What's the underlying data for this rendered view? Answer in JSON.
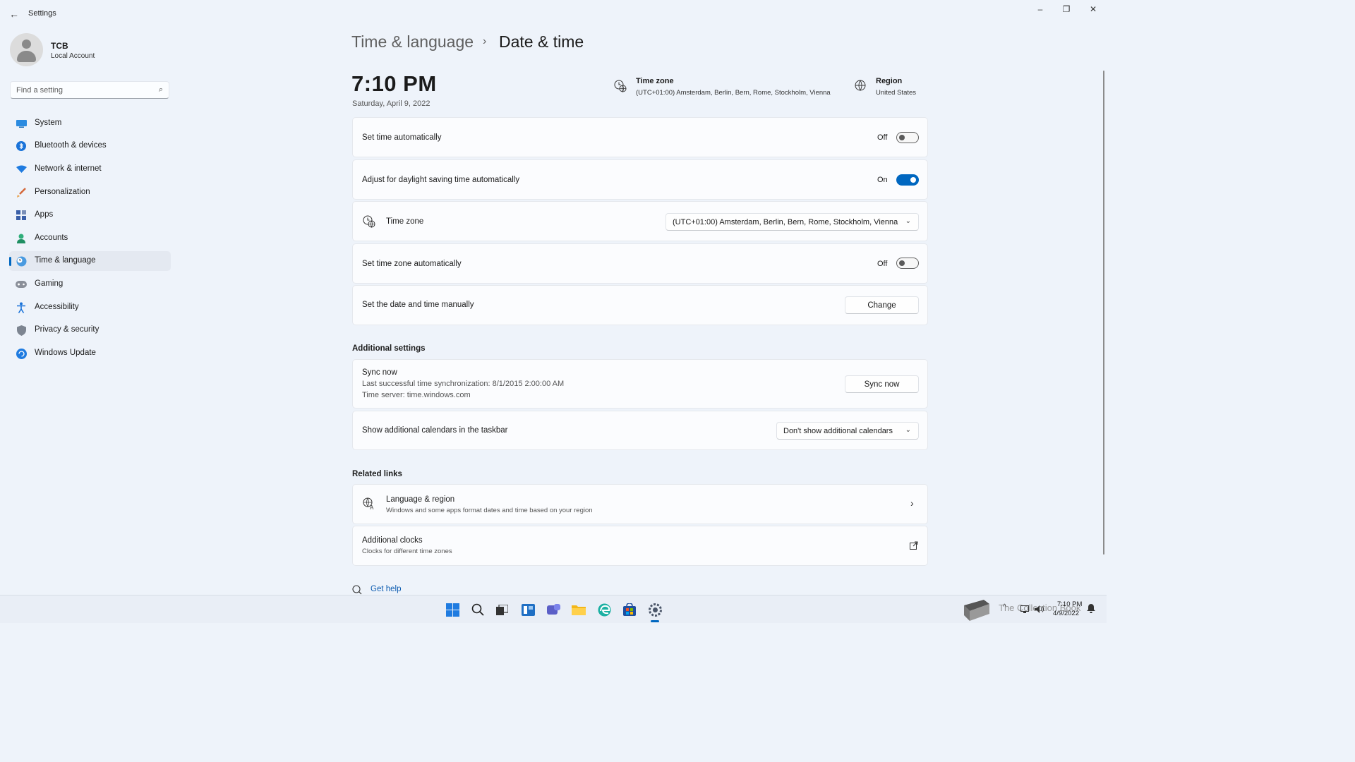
{
  "window": {
    "title": "Settings",
    "minimize": "–",
    "maximize": "❐",
    "close": "✕"
  },
  "profile": {
    "name": "TCB",
    "account_type": "Local Account"
  },
  "search": {
    "placeholder": "Find a setting"
  },
  "nav": [
    {
      "label": "System",
      "icon": "monitor-icon"
    },
    {
      "label": "Bluetooth & devices",
      "icon": "bluetooth-icon"
    },
    {
      "label": "Network & internet",
      "icon": "wifi-icon"
    },
    {
      "label": "Personalization",
      "icon": "brush-icon"
    },
    {
      "label": "Apps",
      "icon": "apps-icon"
    },
    {
      "label": "Accounts",
      "icon": "person-icon"
    },
    {
      "label": "Time & language",
      "icon": "globe-clock-icon",
      "active": true
    },
    {
      "label": "Gaming",
      "icon": "gamepad-icon"
    },
    {
      "label": "Accessibility",
      "icon": "accessibility-icon"
    },
    {
      "label": "Privacy & security",
      "icon": "shield-icon"
    },
    {
      "label": "Windows Update",
      "icon": "update-icon"
    }
  ],
  "breadcrumb": {
    "parent": "Time & language",
    "separator": "›",
    "current": "Date & time"
  },
  "header": {
    "time": "7:10 PM",
    "date": "Saturday, April 9, 2022",
    "timezone_label": "Time zone",
    "timezone_value": "(UTC+01:00) Amsterdam, Berlin, Bern, Rome, Stockholm, Vienna",
    "region_label": "Region",
    "region_value": "United States"
  },
  "settings": {
    "set_time_auto": {
      "label": "Set time automatically",
      "state": "Off"
    },
    "daylight": {
      "label": "Adjust for daylight saving time automatically",
      "state": "On"
    },
    "time_zone": {
      "label": "Time zone",
      "value": "(UTC+01:00) Amsterdam, Berlin, Bern, Rome, Stockholm, Vienna"
    },
    "set_tz_auto": {
      "label": "Set time zone automatically",
      "state": "Off"
    },
    "manual": {
      "label": "Set the date and time manually",
      "button": "Change"
    }
  },
  "additional": {
    "title": "Additional settings",
    "sync": {
      "title": "Sync now",
      "last_sync": "Last successful time synchronization: 8/1/2015 2:00:00 AM",
      "server": "Time server: time.windows.com",
      "button": "Sync now"
    },
    "calendars": {
      "label": "Show additional calendars in the taskbar",
      "value": "Don't show additional calendars"
    }
  },
  "related": {
    "title": "Related links",
    "language_region": {
      "title": "Language & region",
      "desc": "Windows and some apps format dates and time based on your region"
    },
    "clocks": {
      "title": "Additional clocks",
      "desc": "Clocks for different time zones"
    }
  },
  "help": {
    "label": "Get help"
  },
  "taskbar": {
    "icons": [
      "start-icon",
      "search-icon",
      "task-view-icon",
      "widgets-icon",
      "chat-icon",
      "file-explorer-icon",
      "edge-icon",
      "store-icon",
      "settings-icon"
    ],
    "watermark": "The Collection Book",
    "clock_time": "7:10 PM",
    "clock_date": "4/9/2022"
  },
  "colors": {
    "accent": "#0067c0",
    "background": "#eef3fa",
    "card": "#fbfcfe"
  }
}
